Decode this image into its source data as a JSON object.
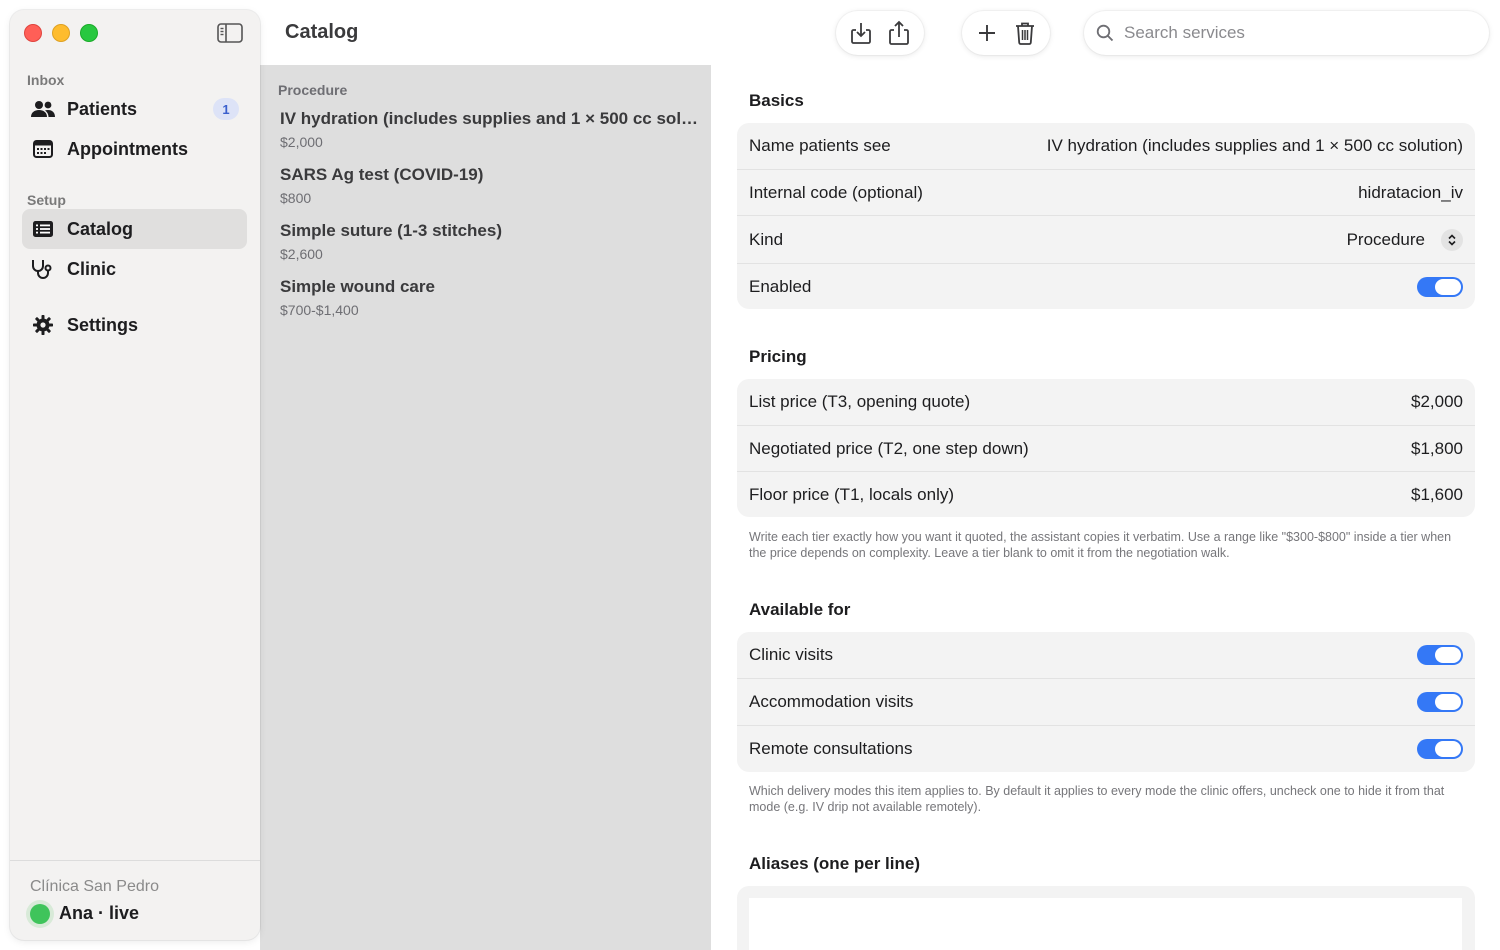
{
  "app": {
    "title": "Catalog"
  },
  "sidebar": {
    "sections": [
      {
        "label": "Inbox"
      },
      {
        "label": "Setup"
      }
    ],
    "items": [
      {
        "label": "Patients",
        "badge": "1"
      },
      {
        "label": "Appointments"
      },
      {
        "label": "Catalog"
      },
      {
        "label": "Clinic"
      },
      {
        "label": "Settings"
      }
    ],
    "footer": {
      "clinic": "Clínica San Pedro",
      "status": "Ana · live",
      "status_color": "#3fc45b"
    }
  },
  "search": {
    "placeholder": "Search services",
    "value": ""
  },
  "list": {
    "header": "Procedure",
    "items": [
      {
        "title": "IV hydration (includes supplies and 1 × 500 cc solution)",
        "price": "$2,000"
      },
      {
        "title": "SARS Ag test (COVID-19)",
        "price": "$800"
      },
      {
        "title": "Simple suture (1-3 stitches)",
        "price": "$2,600"
      },
      {
        "title": "Simple wound care",
        "price": "$700-$1,400"
      }
    ]
  },
  "detail": {
    "basics": {
      "title": "Basics",
      "rows": [
        {
          "label": "Name patients see",
          "value": "IV hydration (includes supplies and 1 × 500 cc solution)"
        },
        {
          "label": "Internal code (optional)",
          "value": "hidratacion_iv"
        },
        {
          "label": "Kind",
          "value": "Procedure"
        },
        {
          "label": "Enabled",
          "value": "on"
        }
      ]
    },
    "pricing": {
      "title": "Pricing",
      "rows": [
        {
          "label": "List price (T3, opening quote)",
          "value": "$2,000"
        },
        {
          "label": "Negotiated price (T2, one step down)",
          "value": "$1,800"
        },
        {
          "label": "Floor price (T1, locals only)",
          "value": "$1,600"
        }
      ],
      "help": "Write each tier exactly how you want it quoted, the assistant copies it verbatim. Use a range like \"$300-$800\" inside a tier when the price depends on complexity. Leave a tier blank to omit it from the negotiation walk."
    },
    "available": {
      "title": "Available for",
      "rows": [
        {
          "label": "Clinic visits",
          "value": "on"
        },
        {
          "label": "Accommodation visits",
          "value": "on"
        },
        {
          "label": "Remote consultations",
          "value": "on"
        }
      ],
      "help": "Which delivery modes this item applies to. By default it applies to every mode the clinic offers, uncheck one to hide it from that mode (e.g. IV drip not available remotely)."
    },
    "aliases": {
      "title": "Aliases (one per line)",
      "value": ""
    }
  },
  "colors": {
    "accent": "#3478f6",
    "badge_bg": "#dde3f7",
    "badge_text": "#3a5fcd"
  }
}
